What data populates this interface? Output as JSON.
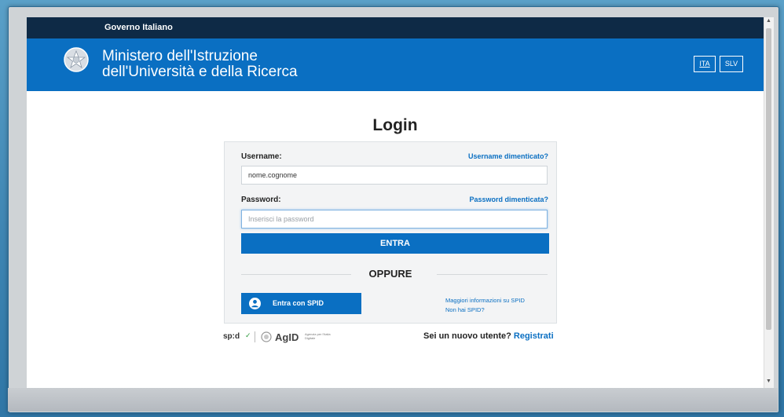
{
  "header": {
    "gov_label": "Governo Italiano",
    "ministry_line1": "Ministero dell'Istruzione",
    "ministry_line2": "dell'Università e della Ricerca",
    "languages": [
      "ITA",
      "SLV"
    ]
  },
  "login": {
    "title": "Login",
    "username_label": "Username:",
    "username_forgot": "Username dimenticato?",
    "username_value": "nome.cognome",
    "password_label": "Password:",
    "password_forgot": "Password dimenticata?",
    "password_placeholder": "Inserisci la password",
    "submit_label": "ENTRA",
    "or_label": "OPPURE",
    "spid_button_label": "Entra con SPID",
    "spid_more_info": "Maggiori informazioni su SPID",
    "spid_no_spid": "Non hai SPID?"
  },
  "footer": {
    "spid_logo_text": "sp:d",
    "agid_text": "AgID",
    "agid_small": "Agenzia per l'Italia Digitale",
    "register_prompt": "Sei un nuovo utente?",
    "register_link": "Registrati"
  },
  "colors": {
    "primary": "#0a6fc2",
    "top_bar": "#0e2a46"
  }
}
